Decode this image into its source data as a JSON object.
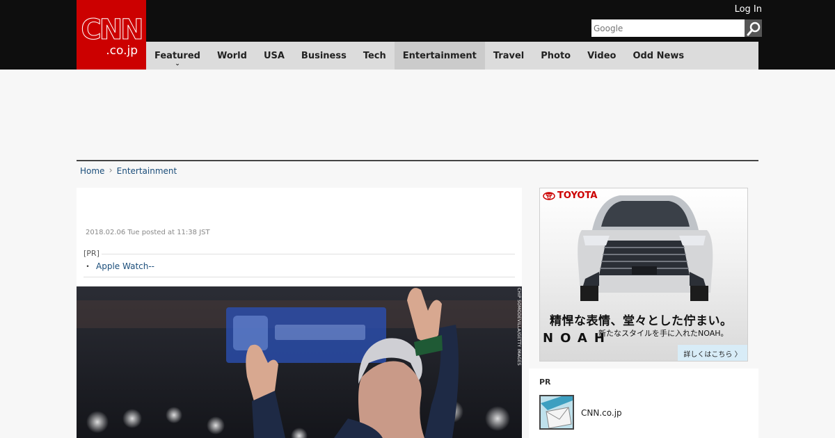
{
  "header": {
    "logo_main": "CNN",
    "logo_sub": ".co.jp",
    "login_label": "Log In",
    "search": {
      "placeholder": "Google",
      "value": ""
    }
  },
  "nav": {
    "items": [
      {
        "label": "Featured",
        "active": false,
        "has_dropdown": true
      },
      {
        "label": "World",
        "active": false
      },
      {
        "label": "USA",
        "active": false
      },
      {
        "label": "Business",
        "active": false
      },
      {
        "label": "Tech",
        "active": false
      },
      {
        "label": "Entertainment",
        "active": true
      },
      {
        "label": "Travel",
        "active": false
      },
      {
        "label": "Photo",
        "active": false
      },
      {
        "label": "Video",
        "active": false
      },
      {
        "label": "Odd News",
        "active": false
      }
    ]
  },
  "breadcrumb": {
    "home": "Home",
    "current": "Entertainment"
  },
  "article": {
    "date": "2018.02.06 Tue posted at 11:38 JST",
    "pr_label": "[PR]",
    "pr_link": "Apple Watch--",
    "photo_credit": "CHIP SOMODEVILLA/GETTY IMAGES"
  },
  "sidebar": {
    "ad": {
      "brand": "TOYOTA",
      "headline": "精悍な表情、堂々とした佇まい。",
      "subline": "新たなスタイルを手に入れたNOAH。",
      "model": "NOAH",
      "cta": "詳しくはこちら 〉"
    },
    "pr_card": {
      "title": "PR",
      "text": "CNN.co.jp"
    }
  },
  "colors": {
    "brand_red": "#cc0000",
    "header_bg": "#0e0e0e",
    "nav_bg": "#dcdcdc",
    "link_blue": "#1a4d7a"
  }
}
